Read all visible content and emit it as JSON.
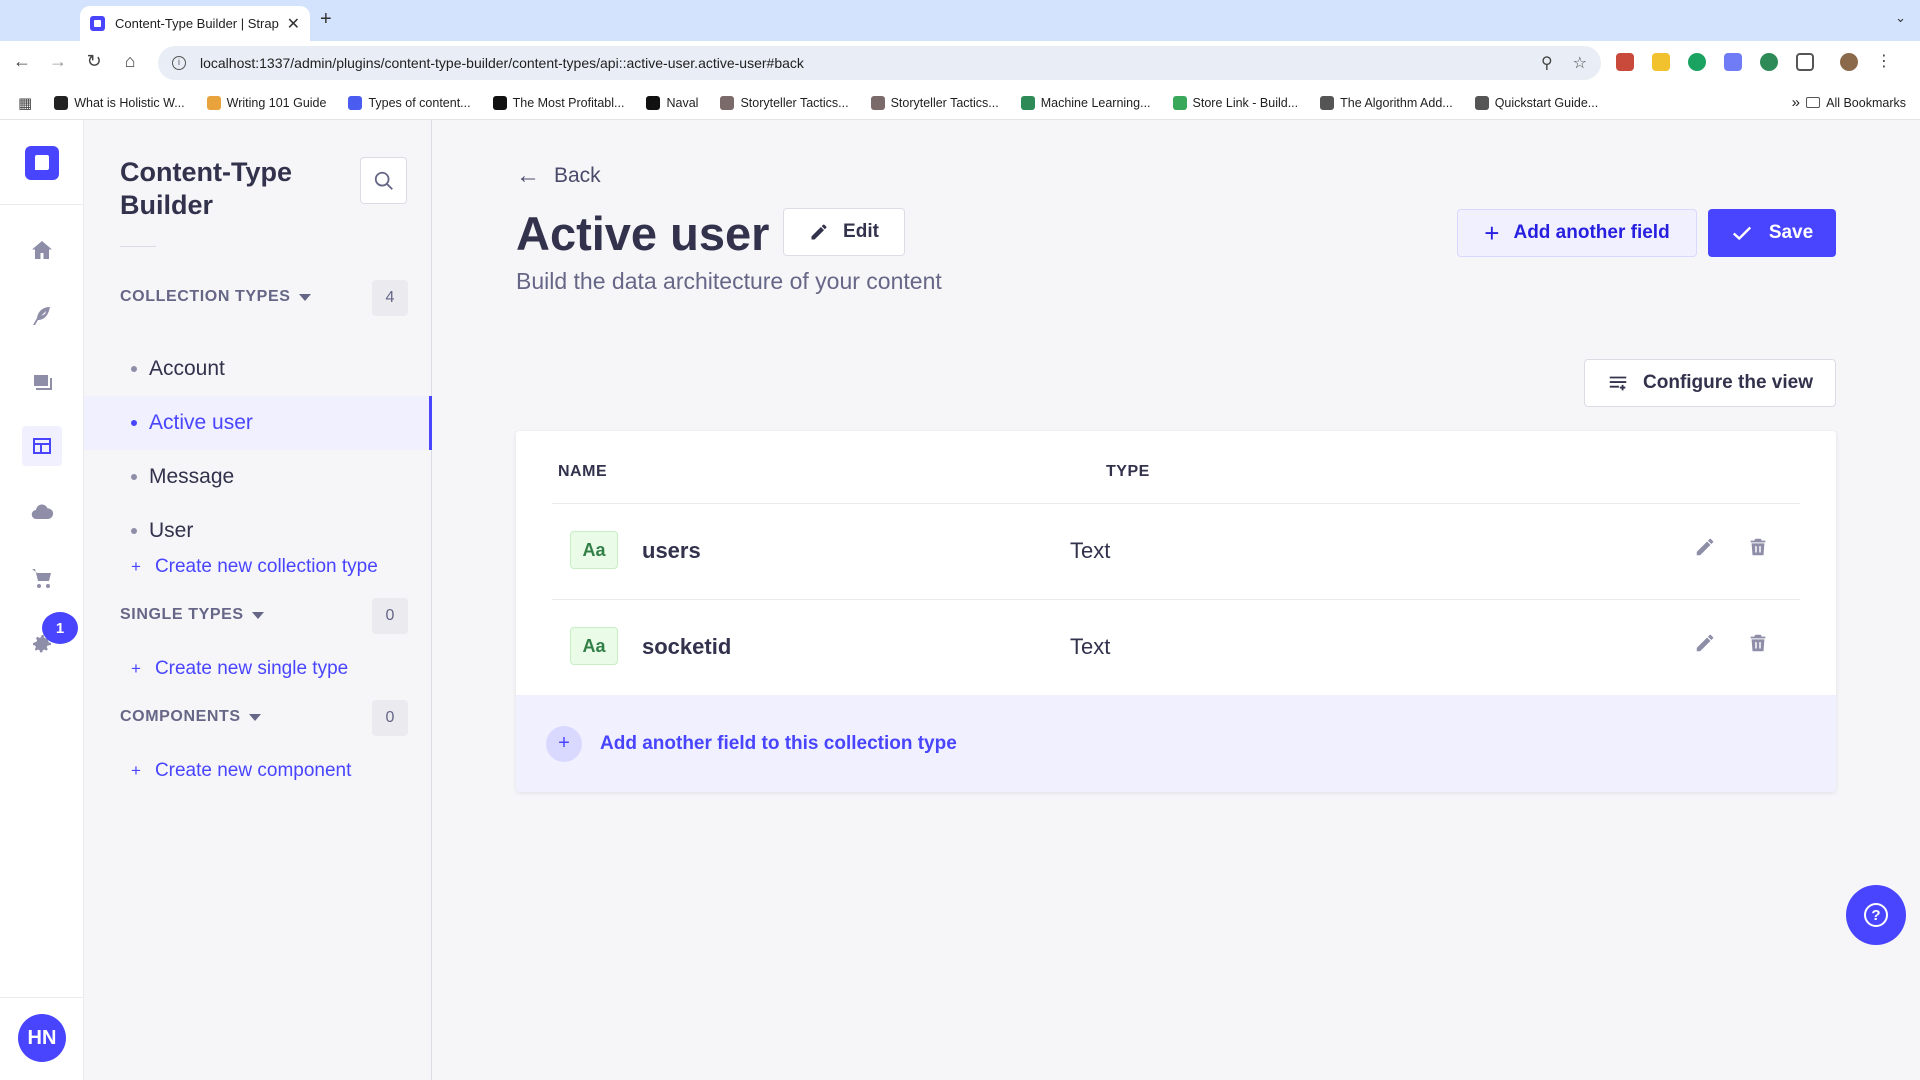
{
  "browser": {
    "tab_title": "Content-Type Builder | Strapi",
    "url": "localhost:1337/admin/plugins/content-type-builder/content-types/api::active-user.active-user#back",
    "bookmarks": [
      {
        "label": "What is Holistic W...",
        "icon_color": "#222222"
      },
      {
        "label": "Writing 101 Guide",
        "icon_color": "#e8a33d"
      },
      {
        "label": "Types of content...",
        "icon_color": "#4b5cf0"
      },
      {
        "label": "The Most Profitabl...",
        "icon_color": "#111111"
      },
      {
        "label": "Naval",
        "icon_color": "#111111"
      },
      {
        "label": "Storyteller Tactics...",
        "icon_color": "#7a6a6a"
      },
      {
        "label": "Storyteller Tactics...",
        "icon_color": "#7a6a6a"
      },
      {
        "label": "Machine Learning...",
        "icon_color": "#2e8b57"
      },
      {
        "label": "Store Link - Build...",
        "icon_color": "#3aa85a"
      },
      {
        "label": "The Algorithm Add...",
        "icon_color": "#555555"
      },
      {
        "label": "Quickstart Guide...",
        "icon_color": "#555555"
      }
    ],
    "more_bookmarks": "»",
    "all_bookmarks": "All Bookmarks"
  },
  "nav": {
    "badge_count": "1",
    "avatar_initials": "HN"
  },
  "subnav": {
    "title": "Content-Type Builder",
    "collection_types": {
      "label": "COLLECTION TYPES",
      "count": "4",
      "items": [
        "Account",
        "Active user",
        "Message",
        "User"
      ],
      "active_item": "Active user",
      "create_label": "Create new collection type"
    },
    "single_types": {
      "label": "SINGLE TYPES",
      "count": "0",
      "create_label": "Create new single type"
    },
    "components": {
      "label": "COMPONENTS",
      "count": "0",
      "create_label": "Create new component"
    }
  },
  "main": {
    "back_label": "Back",
    "title": "Active user",
    "edit_label": "Edit",
    "subtitle": "Build the data architecture of your content",
    "add_field_label": "Add another field",
    "save_label": "Save",
    "configure_label": "Configure the view",
    "table": {
      "columns": [
        "NAME",
        "TYPE"
      ],
      "rows": [
        {
          "icon_text": "Aa",
          "name": "users",
          "type": "Text"
        },
        {
          "icon_text": "Aa",
          "name": "socketid",
          "type": "Text"
        }
      ],
      "add_row_label": "Add another field to this collection type"
    }
  },
  "colors": {
    "primary": "#4945ff",
    "text_icon_bg": "#eafbe7",
    "text_icon_fg": "#328048"
  }
}
